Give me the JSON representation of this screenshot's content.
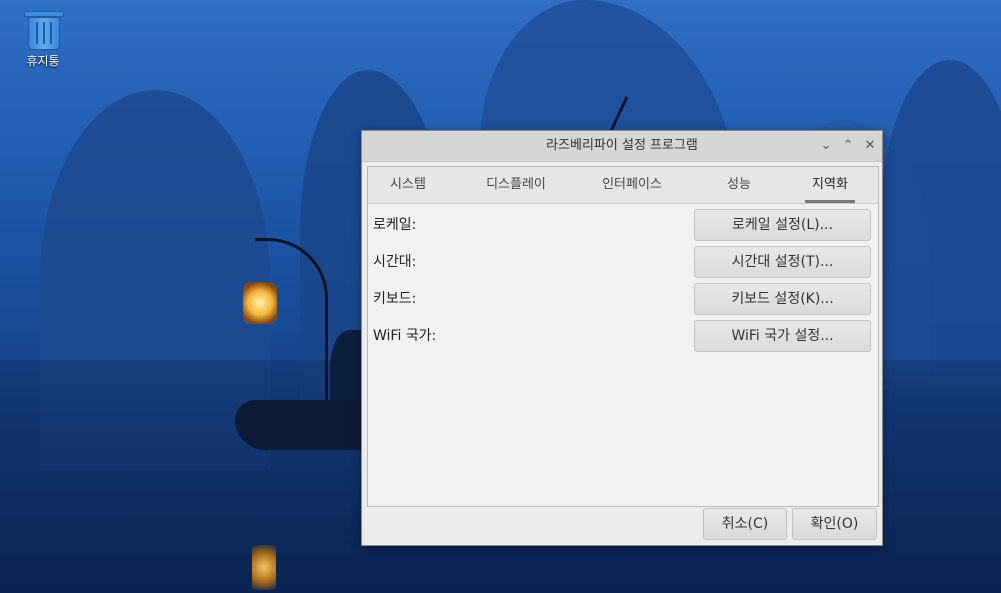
{
  "desktop": {
    "trash_label": "휴지통"
  },
  "dialog": {
    "title": "라즈베리파이 설정 프로그램",
    "tabs": [
      {
        "label": "시스템"
      },
      {
        "label": "디스플레이"
      },
      {
        "label": "인터페이스"
      },
      {
        "label": "성능"
      },
      {
        "label": "지역화"
      }
    ],
    "active_tab": "지역화",
    "rows": [
      {
        "label": "로케일:",
        "button": "로케일 설정(L)..."
      },
      {
        "label": "시간대:",
        "button": "시간대 설정(T)..."
      },
      {
        "label": "키보드:",
        "button": "키보드 설정(K)..."
      },
      {
        "label": "WiFi 국가:",
        "button": "WiFi 국가 설정..."
      }
    ],
    "cancel_label": "취소(C)",
    "ok_label": "확인(O)"
  },
  "colors": {
    "desktop_bg": "#1f5aad",
    "dialog_bg": "#ececec"
  }
}
